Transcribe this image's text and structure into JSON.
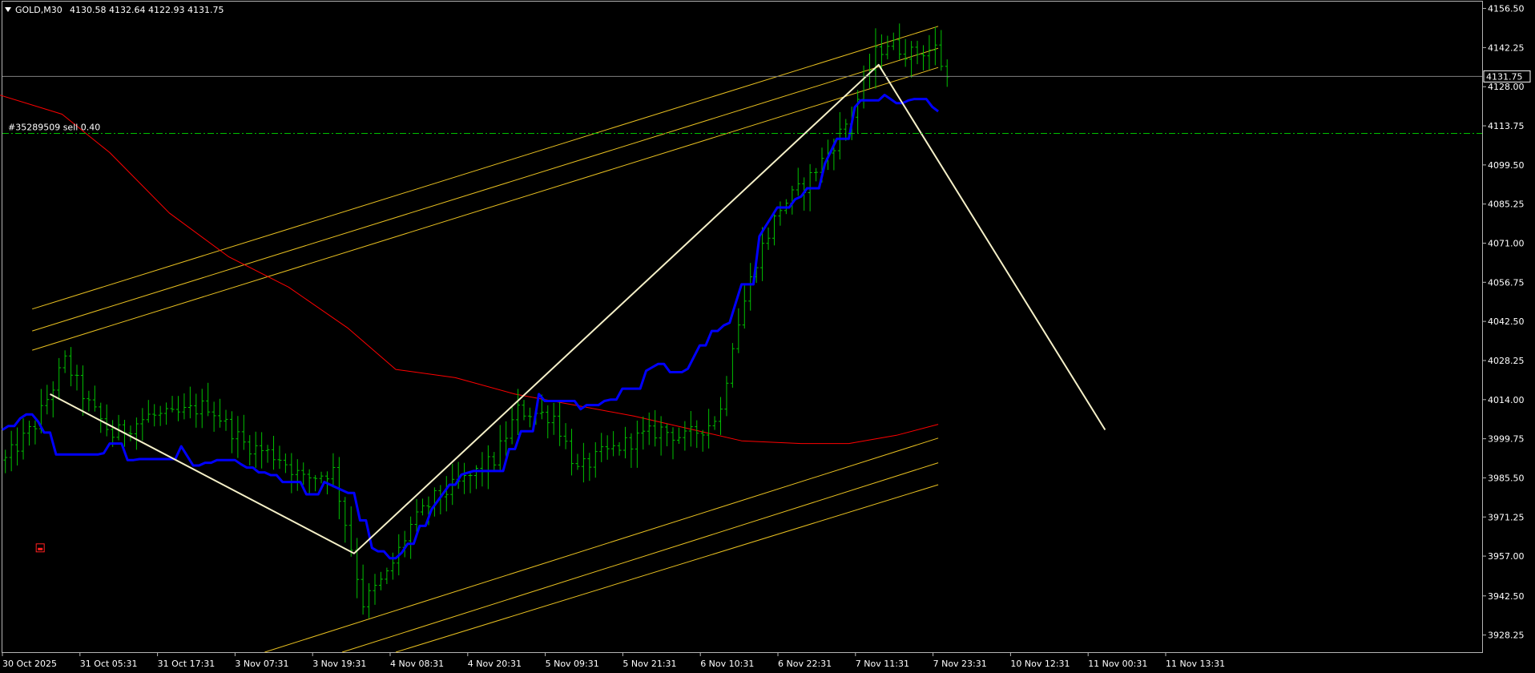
{
  "header": {
    "symbol_menu_icon": "triangle-down-icon",
    "symbol": "GOLD,M30",
    "ohlc": "4130.58 4132.64 4122.93 4131.75"
  },
  "order": {
    "label": "#35289509 sell 0.40",
    "price": 4111.0
  },
  "colors": {
    "background": "#000000",
    "candles": "#00c000",
    "blue_line": "#0000ff",
    "red_ma": "#ff0000",
    "channel": "#e8c020",
    "trend": "#f5f0c8",
    "grid_text": "#ffffff",
    "order_line": "#00c000",
    "current_price_line": "#808080"
  },
  "chart_data": {
    "type": "candlestick",
    "x_axis": {
      "tick_labels": [
        "30 Oct 2025",
        "31 Oct 05:31",
        "31 Oct 17:31",
        "3 Nov 07:31",
        "3 Nov 19:31",
        "4 Nov 08:31",
        "4 Nov 20:31",
        "5 Nov 09:31",
        "5 Nov 21:31",
        "6 Nov 10:31",
        "6 Nov 22:31",
        "7 Nov 11:31",
        "7 Nov 23:31",
        "10 Nov 12:31",
        "11 Nov 00:31",
        "11 Nov 13:31"
      ]
    },
    "y_axis": {
      "range": [
        3922.0,
        4159.0
      ],
      "tick_labels": [
        "4156.50",
        "4142.25",
        "4128.00",
        "4113.75",
        "4099.50",
        "4085.25",
        "4071.00",
        "4056.75",
        "4042.50",
        "4028.25",
        "4014.00",
        "3999.75",
        "3985.50",
        "3971.25",
        "3957.00",
        "3942.50",
        "3928.25"
      ]
    },
    "current_price": {
      "value": 4131.75,
      "label": "4131.75"
    },
    "price_path": {
      "bars": 180,
      "anchors": [
        [
          0,
          3992
        ],
        [
          5,
          4005
        ],
        [
          10,
          4028
        ],
        [
          14,
          4012
        ],
        [
          18,
          4001
        ],
        [
          24,
          4008
        ],
        [
          28,
          4008
        ],
        [
          34,
          4012
        ],
        [
          40,
          3998
        ],
        [
          46,
          3993
        ],
        [
          50,
          3985
        ],
        [
          55,
          3988
        ],
        [
          58,
          3960
        ],
        [
          60,
          3940
        ],
        [
          64,
          3950
        ],
        [
          68,
          3968
        ],
        [
          72,
          3978
        ],
        [
          78,
          3986
        ],
        [
          82,
          3992
        ],
        [
          86,
          4010
        ],
        [
          92,
          4008
        ],
        [
          96,
          3988
        ],
        [
          100,
          3994
        ],
        [
          106,
          4000
        ],
        [
          110,
          4003
        ],
        [
          114,
          4000
        ],
        [
          118,
          4005
        ],
        [
          120,
          4010
        ],
        [
          122,
          4035
        ],
        [
          126,
          4065
        ],
        [
          130,
          4084
        ],
        [
          134,
          4092
        ],
        [
          138,
          4104
        ],
        [
          142,
          4118
        ],
        [
          146,
          4140
        ],
        [
          148,
          4144
        ],
        [
          152,
          4140
        ],
        [
          156,
          4142
        ],
        [
          158,
          4131
        ]
      ]
    },
    "blue_line": {
      "anchors": [
        [
          0,
          4003
        ],
        [
          5,
          4010
        ],
        [
          10,
          3990
        ],
        [
          14,
          3984
        ],
        [
          18,
          3998
        ],
        [
          22,
          3990
        ],
        [
          28,
          4004
        ],
        [
          32,
          3990
        ],
        [
          38,
          3993
        ],
        [
          42,
          3988
        ],
        [
          46,
          3986
        ],
        [
          50,
          3978
        ],
        [
          54,
          3984
        ],
        [
          58,
          3980
        ],
        [
          62,
          3960
        ],
        [
          66,
          3955
        ],
        [
          70,
          3968
        ],
        [
          76,
          3986
        ],
        [
          82,
          3990
        ],
        [
          86,
          3998
        ],
        [
          90,
          4016
        ],
        [
          94,
          4006
        ],
        [
          98,
          4012
        ],
        [
          102,
          4014
        ],
        [
          106,
          4022
        ],
        [
          110,
          4027
        ],
        [
          114,
          4021
        ],
        [
          118,
          4038
        ],
        [
          122,
          4042
        ],
        [
          126,
          4070
        ],
        [
          130,
          4084
        ],
        [
          134,
          4088
        ],
        [
          138,
          4100
        ],
        [
          142,
          4118
        ],
        [
          146,
          4128
        ],
        [
          150,
          4122
        ],
        [
          154,
          4124
        ],
        [
          157,
          4119
        ]
      ]
    },
    "red_ma": {
      "points": [
        [
          -5,
          4128
        ],
        [
          10,
          4118
        ],
        [
          18,
          4104
        ],
        [
          28,
          4082
        ],
        [
          38,
          4066
        ],
        [
          48,
          4055
        ],
        [
          58,
          4040
        ],
        [
          66,
          4025
        ],
        [
          76,
          4022
        ],
        [
          86,
          4016
        ],
        [
          96,
          4012
        ],
        [
          106,
          4008
        ],
        [
          114,
          4004
        ],
        [
          124,
          3999
        ],
        [
          134,
          3998
        ],
        [
          142,
          3998
        ],
        [
          150,
          4001
        ],
        [
          157,
          4005
        ]
      ]
    },
    "zigzag": {
      "points": [
        [
          8,
          4016
        ],
        [
          59,
          3958
        ],
        [
          147,
          4136
        ],
        [
          185,
          4003
        ]
      ]
    },
    "upper_channel": {
      "lines": [
        {
          "points": [
            [
              5,
              4047
            ],
            [
              157,
              4150
            ]
          ]
        },
        {
          "points": [
            [
              5,
              4039
            ],
            [
              157,
              4142
            ]
          ]
        },
        {
          "points": [
            [
              5,
              4032
            ],
            [
              157,
              4135
            ]
          ]
        }
      ]
    },
    "lower_channel": {
      "lines": [
        {
          "points": [
            [
              44,
              3922
            ],
            [
              157,
              4000
            ]
          ]
        },
        {
          "points": [
            [
              57,
              3922
            ],
            [
              157,
              3991
            ]
          ]
        },
        {
          "points": [
            [
              66,
              3922
            ],
            [
              157,
              3983
            ]
          ]
        }
      ]
    },
    "marker": {
      "bar": 5,
      "price": 3960
    }
  }
}
